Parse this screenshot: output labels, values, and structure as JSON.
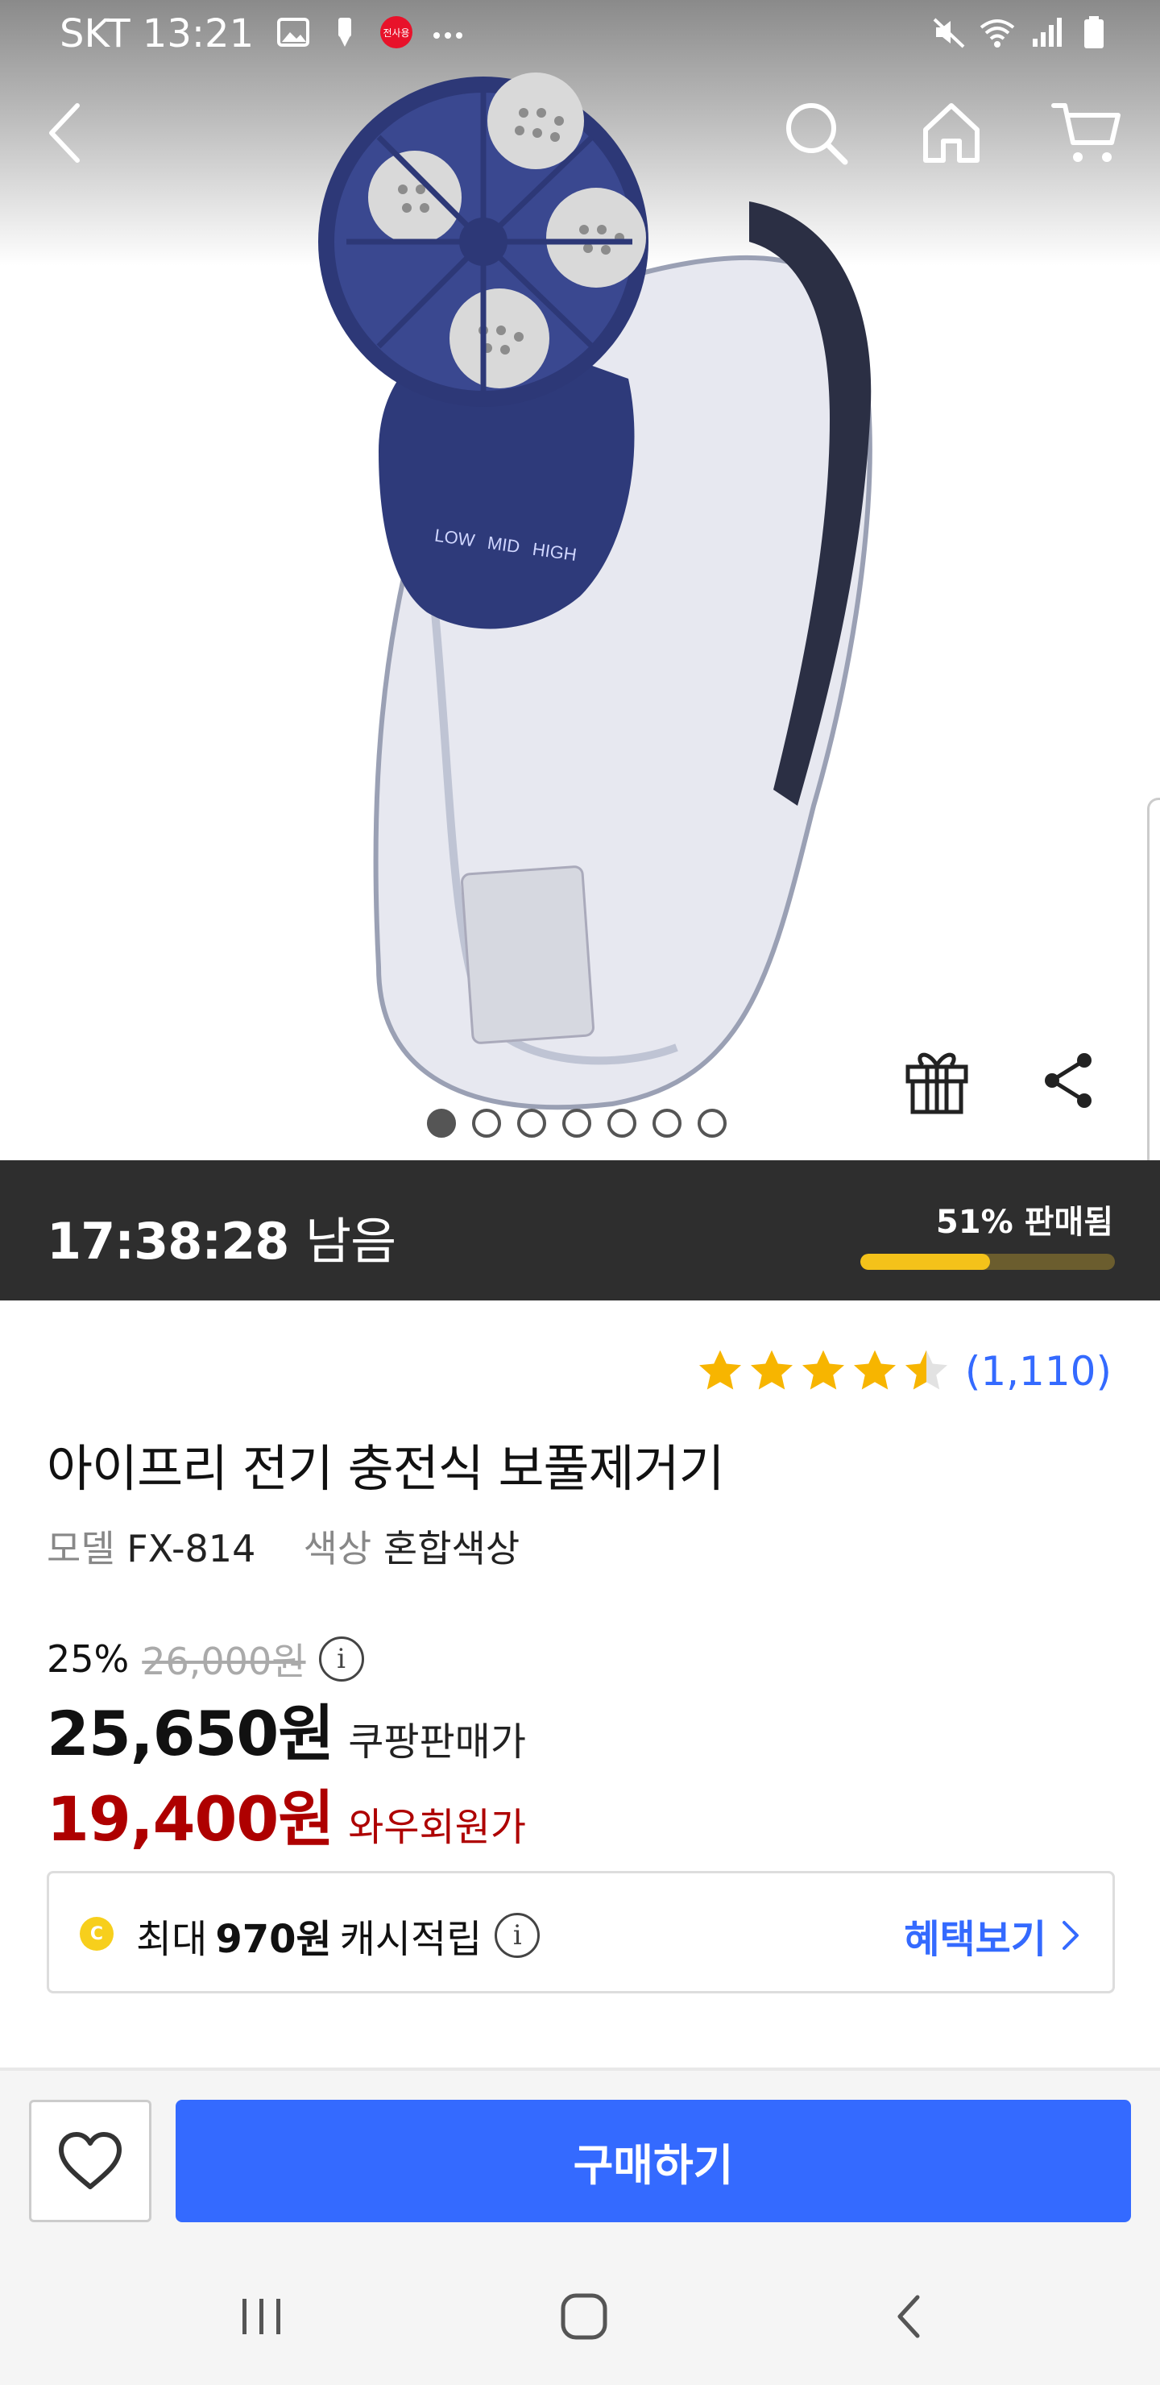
{
  "status_bar": {
    "carrier_time": "SKT 13:21",
    "icons_left": [
      "image-icon",
      "pen-icon",
      "app-badge-icon",
      "more-dots-icon"
    ],
    "app_badge_text": "전사용",
    "icons_right": [
      "mute-icon",
      "wifi-icon",
      "signal-icon",
      "battery-icon"
    ]
  },
  "top_nav": {
    "icons": [
      "back-icon",
      "search-icon",
      "home-icon",
      "cart-icon"
    ]
  },
  "hero": {
    "image_description_icon": "lint-remover-product-image",
    "image_count": 7,
    "active_image_index": 0,
    "actions": [
      "gift-icon",
      "share-icon"
    ],
    "product_markings": {
      "low": "LOW",
      "mid": "MID",
      "high": "HIGH"
    }
  },
  "timer": {
    "time": "17:38:28",
    "suffix": "남음",
    "sold_label": "51% 판매됨",
    "sold_fraction": 0.51
  },
  "rating": {
    "stars": 4.5,
    "count": "(1,110)"
  },
  "product": {
    "title": "아이프리 전기 충전식 보풀제거기",
    "model_label": "모델",
    "model_value": "FX-814",
    "color_label": "색상",
    "color_value": "혼합색상"
  },
  "pricing": {
    "discount": "25%",
    "original_price": "26,000원",
    "sale_price": "25,650원",
    "sale_label": "쿠팡판매가",
    "wow_price": "19,400원",
    "wow_label": "와우회원가"
  },
  "cash": {
    "coin_letter": "C",
    "prefix": "최대",
    "amount": "970원",
    "suffix": "캐시적립",
    "link": "혜택보기"
  },
  "buy_bar": {
    "buy_label": "구매하기"
  },
  "colors": {
    "accent_blue": "#346aff",
    "wow_red": "#ae0000",
    "timer_bg": "#2e2e2e",
    "progress_fill": "#f4c21a",
    "star": "#f7b500"
  }
}
